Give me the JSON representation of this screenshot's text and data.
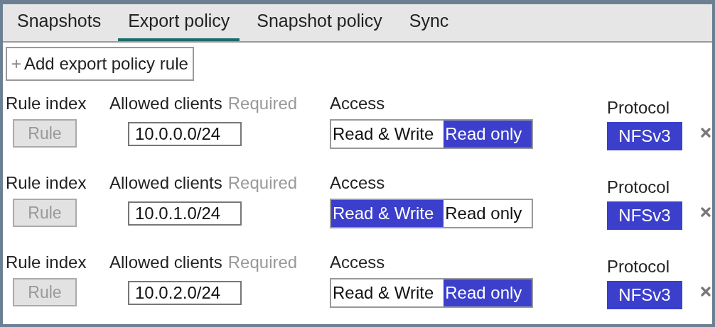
{
  "tabs": [
    {
      "label": "Snapshots",
      "selected": false
    },
    {
      "label": "Export policy",
      "selected": true
    },
    {
      "label": "Snapshot policy",
      "selected": false
    },
    {
      "label": "Sync",
      "selected": false
    }
  ],
  "add_button": {
    "icon": "+",
    "label": "Add export policy rule"
  },
  "rules": [
    {
      "index_label": "Rule index",
      "index_button": {
        "label": "Rule",
        "disabled": true
      },
      "clients_label": "Allowed clients",
      "clients_hint": "Required",
      "clients_value": "10.0.0.0/24",
      "access_label": "Access",
      "access_options": [
        {
          "label": "Read & Write",
          "selected": false
        },
        {
          "label": "Read only",
          "selected": true
        }
      ],
      "protocol_label": "Protocol",
      "protocol": {
        "label": "NFSv3",
        "selected": true
      }
    },
    {
      "index_label": "Rule index",
      "index_button": {
        "label": "Rule",
        "disabled": true
      },
      "clients_label": "Allowed clients",
      "clients_hint": "Required",
      "clients_value": "10.0.1.0/24",
      "access_label": "Access",
      "access_options": [
        {
          "label": "Read & Write",
          "selected": true
        },
        {
          "label": "Read only",
          "selected": false
        }
      ],
      "protocol_label": "Protocol",
      "protocol": {
        "label": "NFSv3",
        "selected": true
      }
    },
    {
      "index_label": "Rule index",
      "index_button": {
        "label": "Rule",
        "disabled": true
      },
      "clients_label": "Allowed clients",
      "clients_hint": "Required",
      "clients_value": "10.0.2.0/24",
      "access_label": "Access",
      "access_options": [
        {
          "label": "Read & Write",
          "selected": false
        },
        {
          "label": "Read only",
          "selected": true
        }
      ],
      "protocol_label": "Protocol",
      "protocol": {
        "label": "NFSv3",
        "selected": true
      }
    }
  ]
}
